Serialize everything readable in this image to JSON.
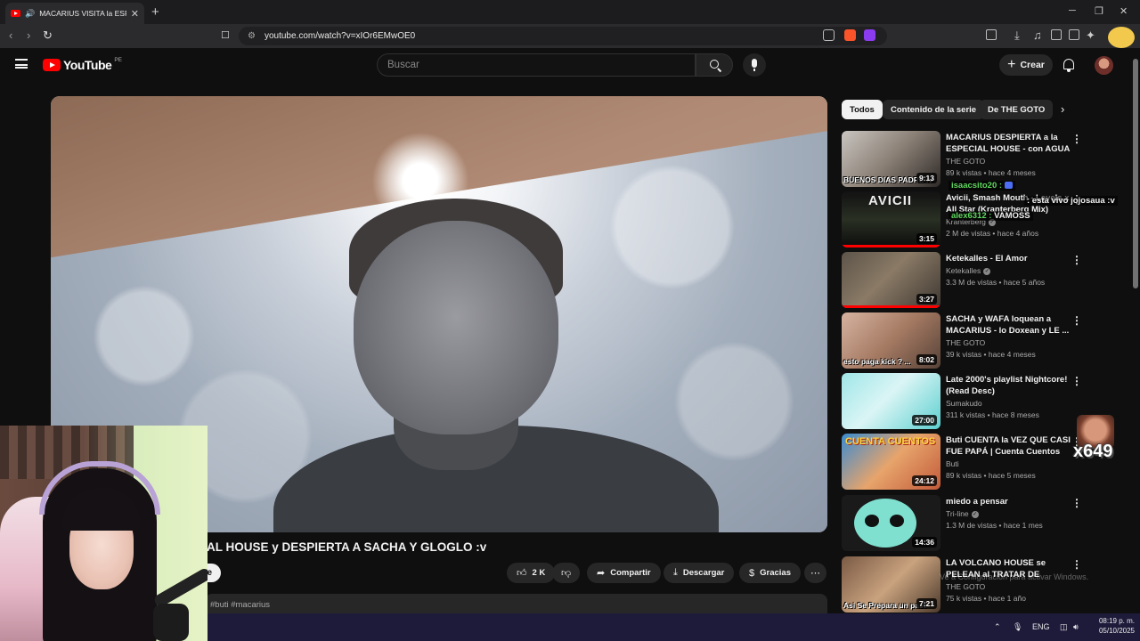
{
  "browser": {
    "tab_title": "MACARIUS VISITA la ESPECIAL",
    "new_tab": "+",
    "url": "youtube.com/watch?v=xIOr6EMwOE0"
  },
  "masthead": {
    "logo_text": "YouTube",
    "region": "PE",
    "search_placeholder": "Buscar",
    "create_label": "Crear"
  },
  "video": {
    "title": "AL HOUSE y DESPIERTA A SACHA Y GLOGLO :v",
    "subscribe_partial": "e",
    "likes": "2 K",
    "share_label": "Compartir",
    "download_label": "Descargar",
    "thanks_label": "Gracias",
    "description_tags": "#buti #macarius"
  },
  "chips": [
    "Todos",
    "Contenido de la serie",
    "De THE GOTO"
  ],
  "recommendations": [
    {
      "title": "MACARIUS DESPIERTA a la ESPECIAL HOUSE - con AGUA ...",
      "channel": "THE GOTO",
      "meta": "89 k vistas • hace 4 meses",
      "duration": "9:13",
      "caption": "BUENOS DIAS PADRE :v",
      "verified": false
    },
    {
      "title": "Avicii, Smash Mouth - Levels x All Star (Kranterberg Mix)",
      "channel": "Kranterberg",
      "meta": "2 M de vistas • hace 4 años",
      "duration": "3:15",
      "caption": "",
      "verified": true
    },
    {
      "title": "Ketekalles - El Amor",
      "channel": "Ketekalles",
      "meta": "3.3 M de vistas • hace 5 años",
      "duration": "3:27",
      "caption": "",
      "verified": true
    },
    {
      "title": "SACHA y WAFA loquean a MACARIUS - lo Doxean y LE ...",
      "channel": "THE GOTO",
      "meta": "39 k vistas • hace 4 meses",
      "duration": "8:02",
      "caption": "esto paga kick ? ...",
      "verified": false
    },
    {
      "title": "Late 2000's playlist Nightcore! (Read Desc)",
      "channel": "Sumakudo",
      "meta": "311 k vistas • hace 8 meses",
      "duration": "27:00",
      "caption": "",
      "verified": false
    },
    {
      "title": "Buti CUENTA la VEZ QUE CASI FUE PAPÁ | Cuenta Cuentos",
      "channel": "Buti",
      "meta": "89 k vistas • hace 5 meses",
      "duration": "24:12",
      "caption": "",
      "verified": false
    },
    {
      "title": "miedo a pensar",
      "channel": "Tri-line",
      "meta": "1.3 M de vistas • hace 1 mes",
      "duration": "14:36",
      "caption": "",
      "verified": true
    },
    {
      "title": "LA VOLCANO HOUSE se PELEAN al TRATAR DE HACER...",
      "channel": "THE GOTO",
      "meta": "75 k vistas • hace 1 año",
      "duration": "7:21",
      "caption": "Asi Se Prepara un past",
      "verified": false
    }
  ],
  "thumb_texts": {
    "avicii": "AVICII",
    "cuenta": "CUENTA CUENTOS"
  },
  "overlay": {
    "chat": [
      {
        "user": "isaacsito20 :",
        "msg": ""
      },
      {
        "user": "",
        "msg": ": esta vivo jojosaua :v"
      },
      {
        "user": "alex6312 :",
        "msg": "VAMOSS"
      }
    ],
    "counter": "x649",
    "watermark": "Ve a Configuración para activar Windows."
  },
  "taskbar": {
    "lang": "ENG",
    "time": "08:19 p. m.",
    "date": "05/10/2025"
  },
  "colors": {
    "accent": "#ff0000",
    "background": "#0f0f0f",
    "chat_name": "#5fd85f"
  }
}
